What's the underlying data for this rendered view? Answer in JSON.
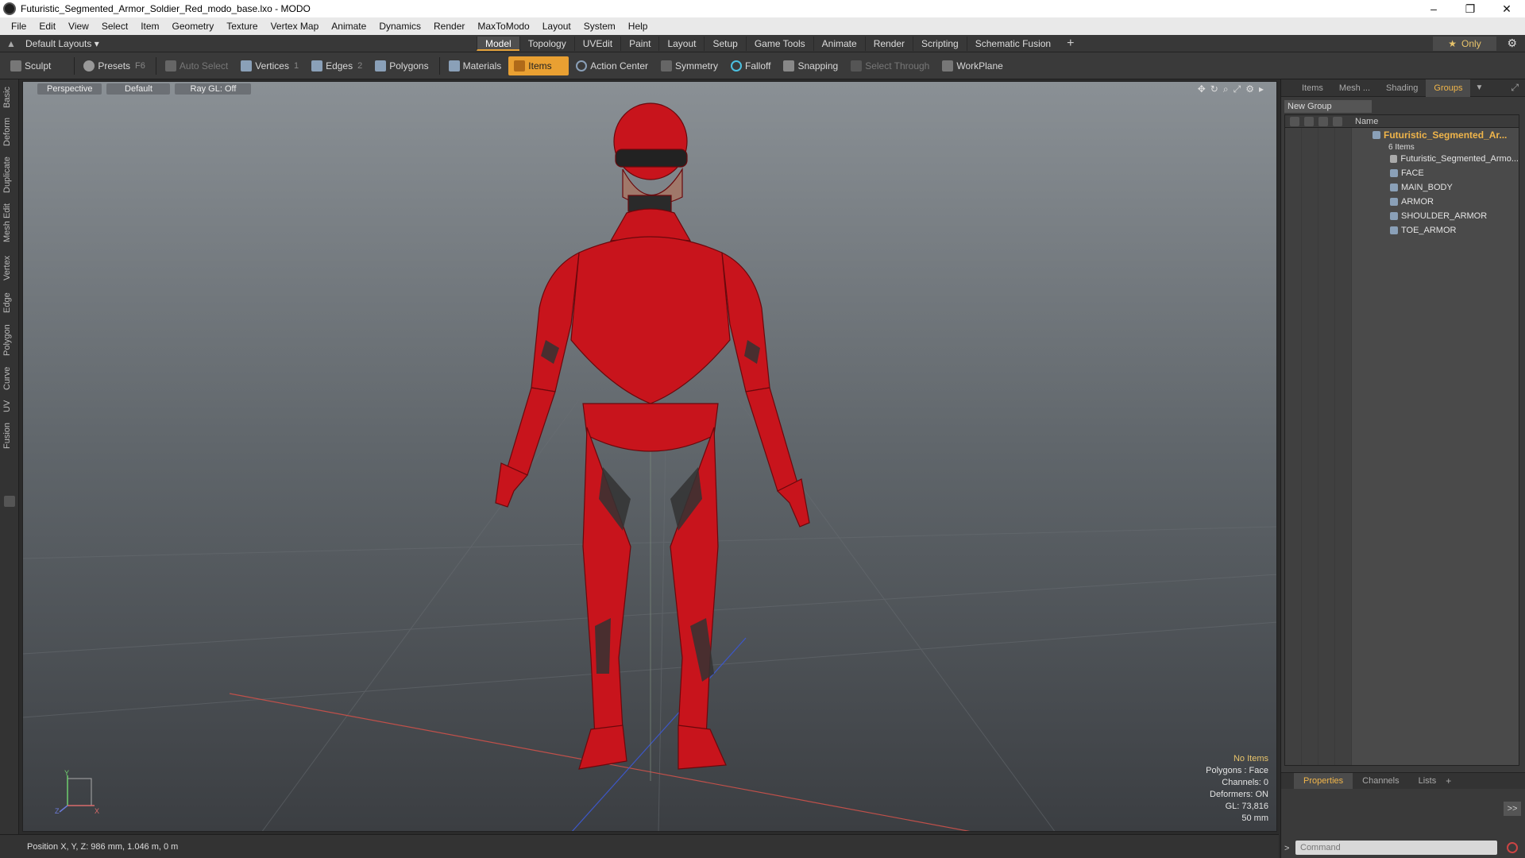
{
  "window": {
    "title": "Futuristic_Segmented_Armor_Soldier_Red_modo_base.lxo - MODO",
    "minimize": "–",
    "maximize": "❐",
    "close": "✕"
  },
  "menu": [
    "File",
    "Edit",
    "View",
    "Select",
    "Item",
    "Geometry",
    "Texture",
    "Vertex Map",
    "Animate",
    "Dynamics",
    "Render",
    "MaxToModo",
    "Layout",
    "System",
    "Help"
  ],
  "layouts": {
    "label": "Default Layouts ▾"
  },
  "modetabs": [
    "Model",
    "Topology",
    "UVEdit",
    "Paint",
    "Layout",
    "Setup",
    "Game Tools",
    "Animate",
    "Render",
    "Scripting",
    "Schematic Fusion"
  ],
  "only": "Only",
  "toolbar": {
    "sculpt": "Sculpt",
    "presets": "Presets",
    "presets_key": "F6",
    "autoselect": "Auto Select",
    "vertices": "Vertices",
    "vertices_key": "1",
    "edges": "Edges",
    "edges_key": "2",
    "polygons": "Polygons",
    "materials": "Materials",
    "items": "Items",
    "actioncenter": "Action Center",
    "symmetry": "Symmetry",
    "falloff": "Falloff",
    "snapping": "Snapping",
    "selectthrough": "Select Through",
    "workplane": "WorkPlane"
  },
  "lefttabs": [
    "Basic",
    "Deform",
    "Duplicate",
    "Mesh Edit",
    "Vertex",
    "Edge",
    "Polygon",
    "Curve",
    "UV",
    "Fusion"
  ],
  "viewport": {
    "view": "Perspective",
    "shading": "Default",
    "raygl": "Ray GL: Off"
  },
  "info": {
    "noitems": "No Items",
    "polygons": "Polygons : Face",
    "channels": "Channels: 0",
    "deformers": "Deformers: ON",
    "gl": "GL: 73,816",
    "scale": "50 mm"
  },
  "axes": {
    "y": "Y",
    "z": "Z",
    "x": "X"
  },
  "status": {
    "position": "Position X, Y, Z:  986 mm, 1.046 m, 0 m"
  },
  "rightpanel": {
    "tabs": [
      "Items",
      "Mesh ...",
      "Shading",
      "Groups"
    ],
    "newgroup": "New Group",
    "namecol": "Name",
    "group": {
      "name": "Futuristic_Segmented_Ar...",
      "count": "6 Items"
    },
    "items": [
      "Futuristic_Segmented_Armo...",
      "FACE",
      "MAIN_BODY",
      "ARMOR",
      "SHOULDER_ARMOR",
      "TOE_ARMOR"
    ]
  },
  "props": {
    "tabs": [
      "Properties",
      "Channels",
      "Lists"
    ],
    "expand": ">>",
    "command": "Command"
  },
  "colors": {
    "accent": "#e9a032",
    "model_red": "#c8141c"
  }
}
